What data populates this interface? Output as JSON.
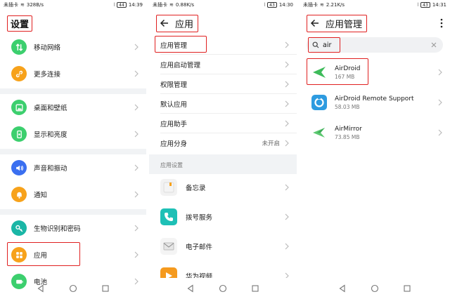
{
  "screens": [
    {
      "status": {
        "carrier": "未插卡",
        "speed": "328B/s",
        "battery": "44",
        "time": "14:39"
      },
      "title": "设置",
      "items": [
        {
          "label": "移动网络",
          "color": "#3ccf6e",
          "icon": "mobile-network-icon"
        },
        {
          "label": "更多连接",
          "color": "#f7a21b",
          "icon": "link-icon"
        },
        {
          "label": "桌面和壁纸",
          "color": "#3ccf6e",
          "icon": "wallpaper-icon"
        },
        {
          "label": "显示和亮度",
          "color": "#3ccf6e",
          "icon": "display-icon"
        },
        {
          "label": "声音和振动",
          "color": "#3a6ff0",
          "icon": "sound-icon"
        },
        {
          "label": "通知",
          "color": "#f7a21b",
          "icon": "notification-icon"
        },
        {
          "label": "生物识别和密码",
          "color": "#1ab6a6",
          "icon": "key-icon"
        },
        {
          "label": "应用",
          "color": "#f7a21b",
          "icon": "apps-icon"
        },
        {
          "label": "电池",
          "color": "#3ccf6e",
          "icon": "battery-icon"
        }
      ]
    },
    {
      "status": {
        "carrier": "未插卡",
        "speed": "0.88K/s",
        "battery": "43",
        "time": "14:30"
      },
      "title": "应用",
      "items": [
        {
          "label": "应用管理",
          "value": ""
        },
        {
          "label": "应用启动管理",
          "value": ""
        },
        {
          "label": "权限管理",
          "value": ""
        },
        {
          "label": "默认应用",
          "value": ""
        },
        {
          "label": "应用助手",
          "value": ""
        },
        {
          "label": "应用分身",
          "value": "未开启"
        }
      ],
      "section_title": "应用设置",
      "apps": [
        {
          "label": "备忘录",
          "icon": "memo-icon"
        },
        {
          "label": "拨号服务",
          "icon": "phone-icon"
        },
        {
          "label": "电子邮件",
          "icon": "email-icon"
        },
        {
          "label": "华为视频",
          "icon": "video-icon"
        }
      ]
    },
    {
      "status": {
        "carrier": "未插卡",
        "speed": "2.21K/s",
        "battery": "43",
        "time": "14:31"
      },
      "title": "应用管理",
      "search": {
        "value": "air"
      },
      "results": [
        {
          "name": "AirDroid",
          "size": "167 MB",
          "icon": "airdroid-icon"
        },
        {
          "name": "AirDroid Remote Support",
          "size": "58.03 MB",
          "icon": "airdroid-remote-icon"
        },
        {
          "name": "AirMirror",
          "size": "73.85 MB",
          "icon": "airmirror-icon"
        }
      ]
    }
  ],
  "colors": {
    "highlight": "#e02020",
    "airdroid_green": "#3dbb5a",
    "remote_blue": "#2d9be0"
  }
}
